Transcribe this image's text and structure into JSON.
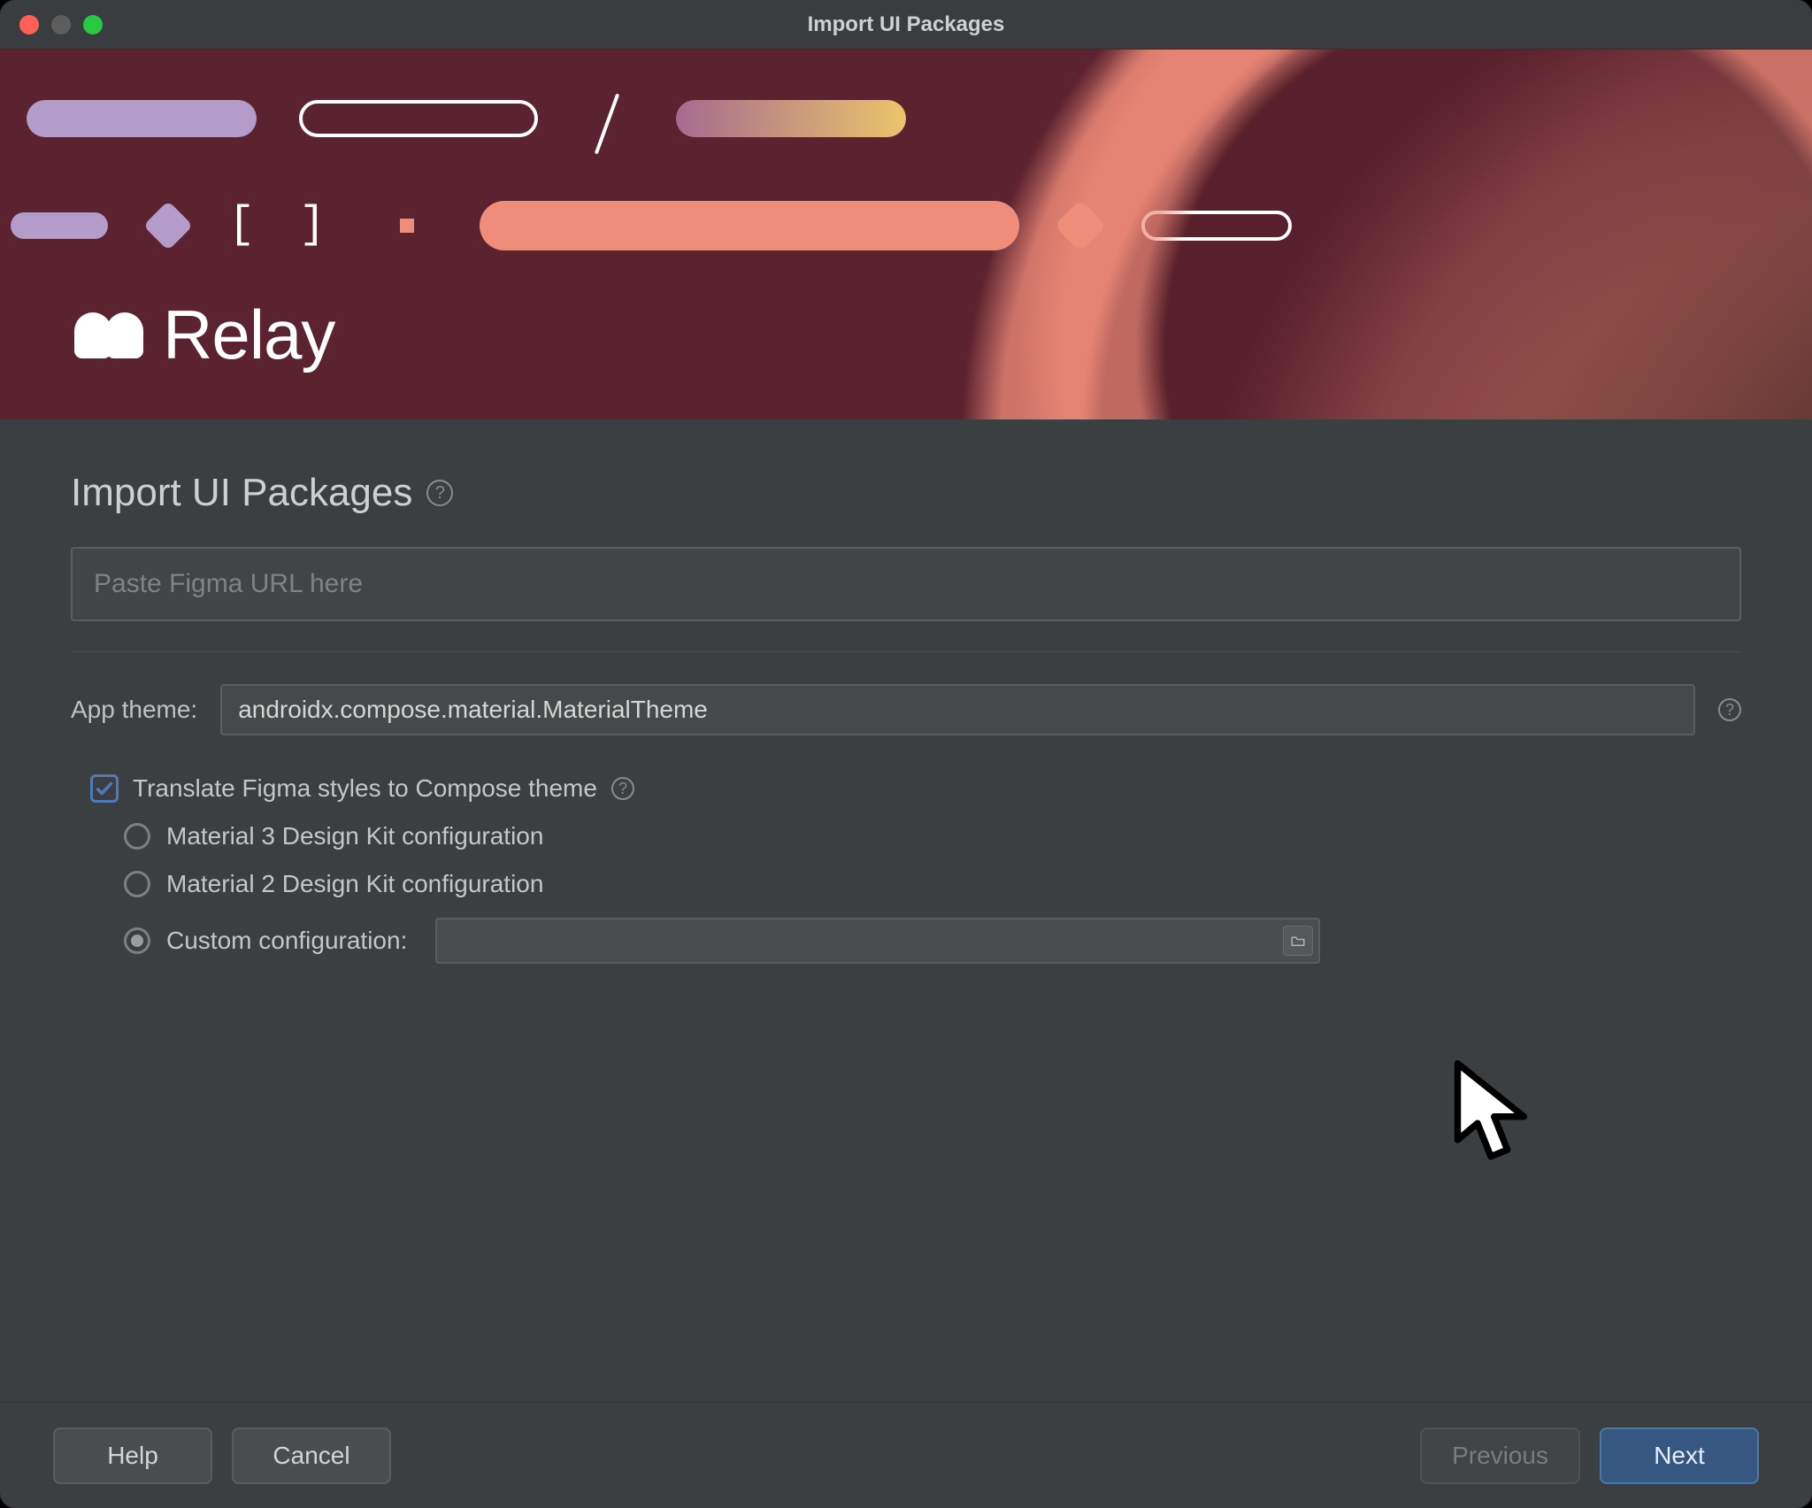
{
  "window": {
    "title": "Import UI Packages"
  },
  "hero": {
    "brand": "Relay"
  },
  "page": {
    "title": "Import UI Packages",
    "url_placeholder": "Paste Figma URL here",
    "url_value": ""
  },
  "theme": {
    "label": "App theme:",
    "value": "androidx.compose.material.MaterialTheme"
  },
  "translate": {
    "checked": true,
    "label": "Translate Figma styles to Compose theme",
    "options": {
      "m3": "Material 3 Design Kit configuration",
      "m2": "Material 2 Design Kit configuration",
      "custom": "Custom configuration:",
      "selected": "custom",
      "custom_value": ""
    }
  },
  "footer": {
    "help": "Help",
    "cancel": "Cancel",
    "previous": "Previous",
    "next": "Next"
  }
}
